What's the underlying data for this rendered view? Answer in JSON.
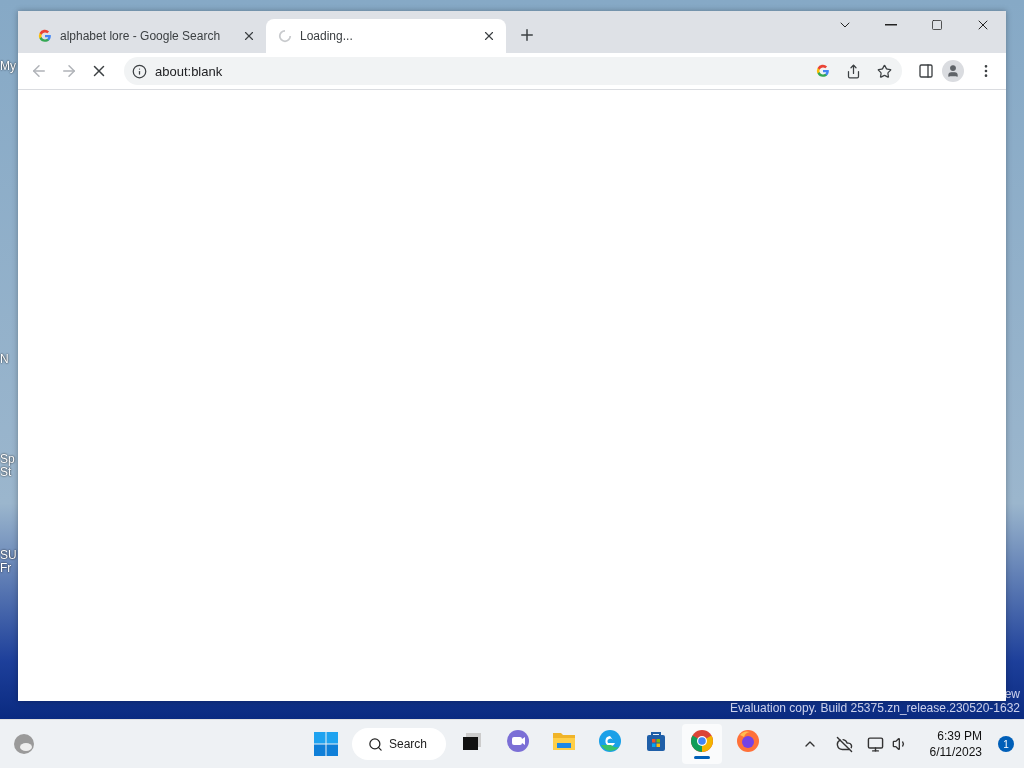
{
  "desktop_icons": [
    {
      "lines": [
        "My"
      ]
    },
    {
      "lines": [
        "N"
      ]
    },
    {
      "lines": [
        "Sp",
        "St"
      ]
    },
    {
      "lines": [
        "SU",
        "Fr"
      ]
    }
  ],
  "browser": {
    "tabs": [
      {
        "title": "alphabet lore - Google Search",
        "selected": false,
        "loading": false
      },
      {
        "title": "Loading...",
        "selected": true,
        "loading": true
      }
    ],
    "toolbar": {
      "back_disabled": true,
      "forward_disabled": true,
      "loading": true,
      "address": "about:blank"
    }
  },
  "watermark": [
    "ew",
    "Evaluation copy. Build 25375.zn_release.230520-1632"
  ],
  "taskbar": {
    "search": "Search",
    "apps": [
      {
        "kind": "taskview",
        "selected": false
      },
      {
        "kind": "chat",
        "selected": false
      },
      {
        "kind": "explorer",
        "selected": false
      },
      {
        "kind": "edge",
        "selected": false
      },
      {
        "kind": "store",
        "selected": false
      },
      {
        "kind": "chrome",
        "selected": true
      },
      {
        "kind": "firefox",
        "selected": false
      }
    ],
    "time": "6:39 PM",
    "date": "6/11/2023",
    "notifications": "1"
  }
}
